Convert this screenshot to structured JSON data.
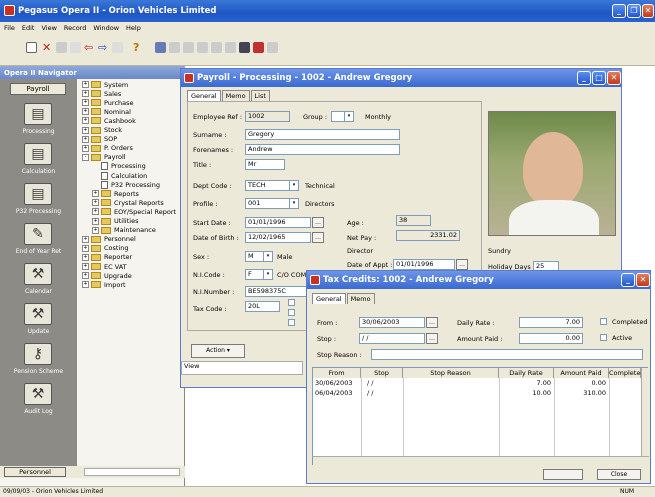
{
  "app": {
    "title": "Pegasus Opera II - Orion Vehicles Limited"
  },
  "menu": [
    "File",
    "Edit",
    "View",
    "Record",
    "Window",
    "Help"
  ],
  "navigator": {
    "title": "Opera II Navigator",
    "tab": "Payroll",
    "footer_tab": "Personnel",
    "items": [
      "Processing",
      "Calculation",
      "P32 Processing",
      "End of Year Ret",
      "Calendar",
      "Update",
      "Pension Scheme",
      "Audit Log"
    ],
    "tree": [
      {
        "label": "System",
        "level": 0,
        "kind": "folder",
        "toggle": "+"
      },
      {
        "label": "Sales",
        "level": 0,
        "kind": "folder",
        "toggle": "+"
      },
      {
        "label": "Purchase",
        "level": 0,
        "kind": "folder",
        "toggle": "+"
      },
      {
        "label": "Nominal",
        "level": 0,
        "kind": "folder",
        "toggle": "+"
      },
      {
        "label": "Cashbook",
        "level": 0,
        "kind": "folder",
        "toggle": "+"
      },
      {
        "label": "Stock",
        "level": 0,
        "kind": "folder",
        "toggle": "+"
      },
      {
        "label": "SOP",
        "level": 0,
        "kind": "folder",
        "toggle": "+"
      },
      {
        "label": "P. Orders",
        "level": 0,
        "kind": "folder",
        "toggle": "+"
      },
      {
        "label": "Payroll",
        "level": 0,
        "kind": "folder",
        "toggle": "-"
      },
      {
        "label": "Processing",
        "level": 1,
        "kind": "doc",
        "toggle": ""
      },
      {
        "label": "Calculation",
        "level": 1,
        "kind": "doc",
        "toggle": ""
      },
      {
        "label": "P32 Processing",
        "level": 1,
        "kind": "doc",
        "toggle": ""
      },
      {
        "label": "Reports",
        "level": 1,
        "kind": "folder",
        "toggle": "+"
      },
      {
        "label": "Crystal Reports",
        "level": 1,
        "kind": "folder",
        "toggle": "+"
      },
      {
        "label": "EOY/Special Report",
        "level": 1,
        "kind": "folder",
        "toggle": "+"
      },
      {
        "label": "Utilities",
        "level": 1,
        "kind": "folder",
        "toggle": "+"
      },
      {
        "label": "Maintenance",
        "level": 1,
        "kind": "folder",
        "toggle": "+"
      },
      {
        "label": "Personnel",
        "level": 0,
        "kind": "folder",
        "toggle": "+"
      },
      {
        "label": "Costing",
        "level": 0,
        "kind": "folder",
        "toggle": "+"
      },
      {
        "label": "Reporter",
        "level": 0,
        "kind": "folder",
        "toggle": "+"
      },
      {
        "label": "EC VAT",
        "level": 0,
        "kind": "folder",
        "toggle": "+"
      },
      {
        "label": "Upgrade",
        "level": 0,
        "kind": "folder",
        "toggle": "+"
      },
      {
        "label": "Import",
        "level": 0,
        "kind": "folder",
        "toggle": "+"
      }
    ]
  },
  "payroll": {
    "title": "Payroll - Processing - 1002 - Andrew Gregory",
    "tabs": [
      "General",
      "Memo",
      "List"
    ],
    "employee_ref_label": "Employee Ref :",
    "employee_ref": "1002",
    "group_label": "Group :",
    "group_value": "Monthly",
    "surname_label": "Surname :",
    "surname": "Gregory",
    "forenames_label": "Forenames :",
    "forenames": "Andrew",
    "title_label": "Title :",
    "title_value": "Mr",
    "dept_label": "Dept Code :",
    "dept": "TECH",
    "dept_name": "Technical",
    "profile_label": "Profile :",
    "profile": "001",
    "profile_name": "Directors",
    "start_label": "Start Date :",
    "start": "01/01/1996",
    "age_label": "Age :",
    "age": "38",
    "dob_label": "Date of Birth :",
    "dob": "12/02/1965",
    "netpay_label": "Net Pay :",
    "netpay": "2331.02",
    "sex_label": "Sex :",
    "sex": "M",
    "sex_name": "Male",
    "director_label": "Director",
    "appt_label": "Date of Appt :",
    "appt": "01/01/1996",
    "sundry_label": "Sundry",
    "holiday_label": "Holiday Days :",
    "holiday": "25",
    "ni_code_label": "N.I.Code :",
    "ni_code": "F",
    "ni_code_name": "C/O COMP Standard",
    "ni_number_label": "N.I.Number :",
    "ni_number": "BE598375C",
    "tax_code_label": "Tax Code :",
    "tax_code": "20L",
    "action_label": "Action",
    "view_label": "View"
  },
  "tax": {
    "title": "Tax Credits: 1002 - Andrew Gregory",
    "tabs": [
      "General",
      "Memo"
    ],
    "from_label": "From :",
    "from": "30/06/2003",
    "stop_label": "Stop :",
    "stop": "/ /",
    "stop_reason_label": "Stop Reason :",
    "daily_rate_label": "Daily Rate :",
    "daily_rate": "7.00",
    "amount_paid_label": "Amount Paid :",
    "amount_paid": "0.00",
    "completed_label": "Completed",
    "active_label": "Active",
    "columns": [
      "From",
      "Stop",
      "Stop Reason",
      "Daily Rate",
      "Amount Paid",
      "Completed"
    ],
    "rows": [
      {
        "from": "30/06/2003",
        "stop": "/ /",
        "reason": "",
        "rate": "7.00",
        "paid": "0.00"
      },
      {
        "from": "06/04/2003",
        "stop": "/ /",
        "reason": "",
        "rate": "10.00",
        "paid": "310.00"
      }
    ],
    "close_label": "Close"
  },
  "status": {
    "left": "09/09/03 - Orion Vehicles Limited",
    "right": "NUM"
  }
}
